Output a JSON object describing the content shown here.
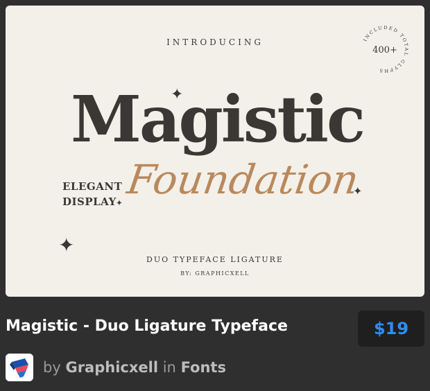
{
  "hero": {
    "introducing": "INTRODUCING",
    "brand_title": "Magistic",
    "script_title": "Foundation",
    "side_line_1": "ELEGANT",
    "side_line_2": "DISPLAY",
    "subtitle": "DUO TYPEFACE LIGATURE",
    "byline": "BY: GRAPHICXELL",
    "badge_count": "400+",
    "badge_ring_text": "INCLUDED TOTAL GLYPHS"
  },
  "product": {
    "title": "Magistic - Duo Ligature Typeface",
    "price": "$19"
  },
  "author": {
    "by_label": "by",
    "name": "Graphicxell",
    "in_label": "in",
    "category": "Fonts"
  },
  "colors": {
    "page_bg": "#2f2f2f",
    "card_bg": "#f3f0ea",
    "dark_text": "#3b3735",
    "script_gold": "#b9895c",
    "price_blue": "#2e8df0"
  },
  "icons": [
    "sparkle-icon",
    "author-logo-icon"
  ]
}
